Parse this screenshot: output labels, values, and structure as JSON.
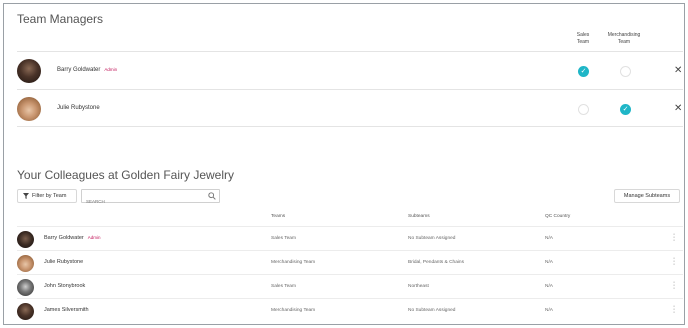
{
  "managers": {
    "title": "Team Managers",
    "columns": [
      "Sales Team",
      "Merchandising Team"
    ],
    "rows": [
      {
        "name": "Barry Goldwater",
        "badge": "Admin",
        "sales": true,
        "merch": false
      },
      {
        "name": "Julie Rubystone",
        "badge": "",
        "sales": false,
        "merch": true
      }
    ],
    "remove_glyph": "✕"
  },
  "colleagues": {
    "title": "Your Colleagues at Golden Fairy Jewelry",
    "filter_label": "Filter by Team",
    "search_placeholder": "SEARCH",
    "manage_label": "Manage Subteams",
    "headers": {
      "teams": "Teams",
      "subteams": "Subteams",
      "qc": "QC Country"
    },
    "rows": [
      {
        "name": "Barry Goldwater",
        "badge": "Admin",
        "team": "Sales Team",
        "subteam": "No Subteam Assigned",
        "qc": "N/A"
      },
      {
        "name": "Julie Rubystone",
        "badge": "",
        "team": "Merchandising Team",
        "subteam": "Bridal, Pendants & Chains",
        "qc": "N/A"
      },
      {
        "name": "John Stonybrook",
        "badge": "",
        "team": "Sales Team",
        "subteam": "Northeast",
        "qc": "N/A"
      },
      {
        "name": "James Silversmith",
        "badge": "",
        "team": "Merchandising Team",
        "subteam": "No Subteam Assigned",
        "qc": "N/A"
      }
    ]
  },
  "colors": {
    "accent": "#1fb6c7",
    "admin": "#c2185b"
  },
  "icons": {
    "filter": "filter-icon",
    "search": "search-icon",
    "check": "check-icon",
    "close": "close-icon",
    "more": "more-vertical-icon"
  }
}
